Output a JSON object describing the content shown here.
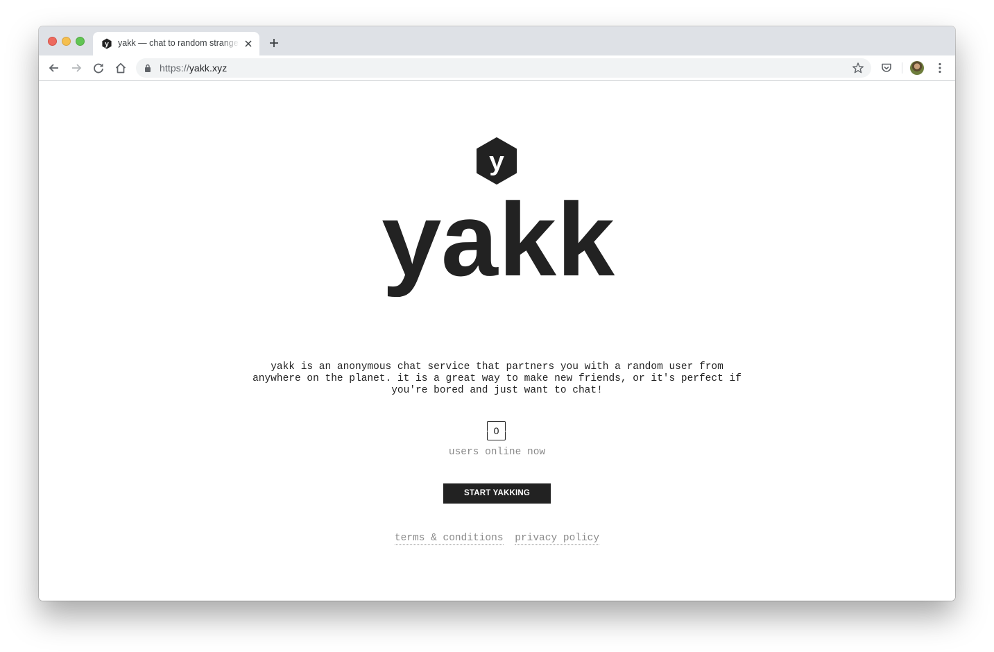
{
  "browser": {
    "tab_title": "yakk — chat to random strangers",
    "url_scheme": "https://",
    "url_host": "yakk.xyz"
  },
  "page": {
    "logo_letter": "y",
    "wordmark": "yakk",
    "description": "yakk is an anonymous chat service that partners you with a random user from anywhere on the planet. it is a great way to make new friends, or it's perfect if you're bored and just want to chat!",
    "users_online_count": "0",
    "users_online_label": "users online now",
    "cta_label": "START YAKKING",
    "footer_links": {
      "terms": "terms & conditions",
      "privacy": "privacy policy"
    }
  },
  "colors": {
    "brand_dark": "#222222",
    "muted_text": "#8a8a8a",
    "background": "#ffffff"
  },
  "icons": {
    "tab_favicon": "yakk-hex-icon",
    "back": "arrow-left-icon",
    "forward": "arrow-right-icon",
    "reload": "reload-icon",
    "home": "home-icon",
    "lock": "lock-icon",
    "bookmark": "star-icon",
    "pocket": "pocket-icon",
    "menu": "kebab-menu-icon"
  }
}
